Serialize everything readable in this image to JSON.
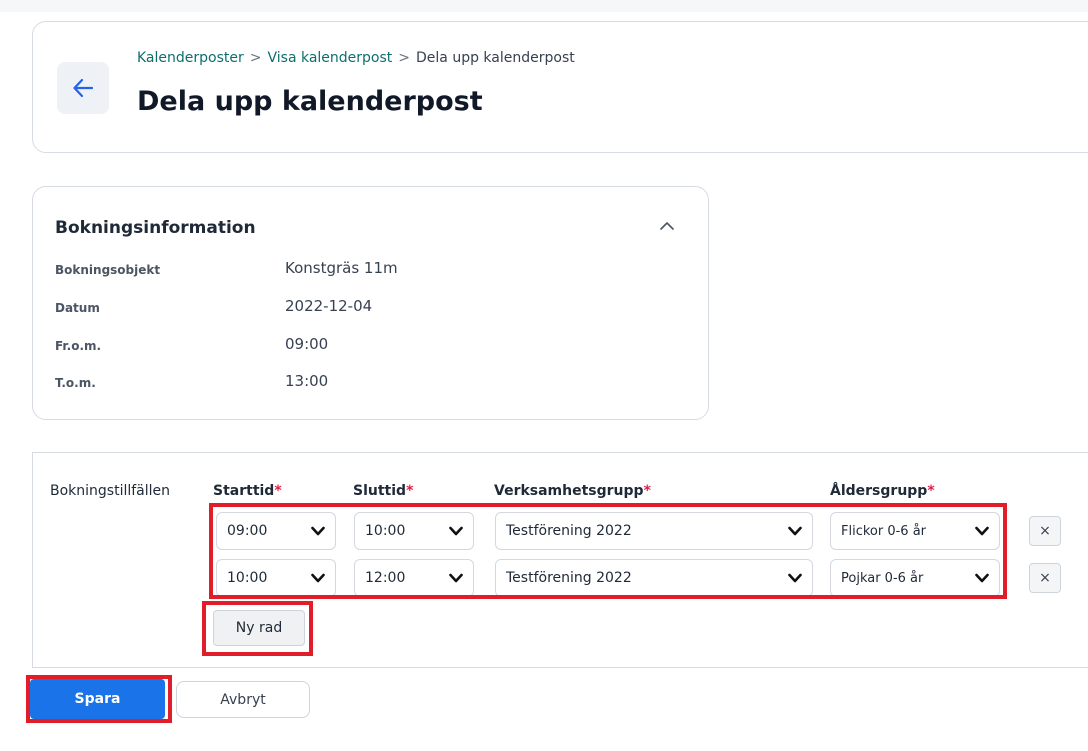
{
  "header": {
    "breadcrumb": [
      "Kalenderposter",
      "Visa kalenderpost",
      "Dela upp kalenderpost"
    ],
    "breadcrumb_separator": ">",
    "title": "Dela upp kalenderpost"
  },
  "booking_info": {
    "title": "Bokningsinformation",
    "rows": [
      {
        "label": "Bokningsobjekt",
        "value": "Konstgräs 11m"
      },
      {
        "label": "Datum",
        "value": "2022-12-04"
      },
      {
        "label": "Fr.o.m.",
        "value": "09:00"
      },
      {
        "label": "T.o.m.",
        "value": "13:00"
      }
    ]
  },
  "occasions": {
    "label": "Bokningstillfällen",
    "columns": [
      "Starttid",
      "Sluttid",
      "Verksamhetsgrupp",
      "Åldersgrupp"
    ],
    "required_marker": "*",
    "rows": [
      {
        "start": "09:00",
        "end": "10:00",
        "group": "Testförening 2022",
        "age": "Flickor 0-6 år",
        "remove": "×"
      },
      {
        "start": "10:00",
        "end": "12:00",
        "group": "Testförening 2022",
        "age": "Pojkar 0-6 år",
        "remove": "×"
      }
    ],
    "new_row_label": "Ny rad"
  },
  "actions": {
    "save": "Spara",
    "cancel": "Avbryt"
  },
  "colors": {
    "primary": "#1a73e8",
    "highlight": "#e11d2a",
    "required": "#e11d48",
    "link": "#0d6e6e"
  }
}
